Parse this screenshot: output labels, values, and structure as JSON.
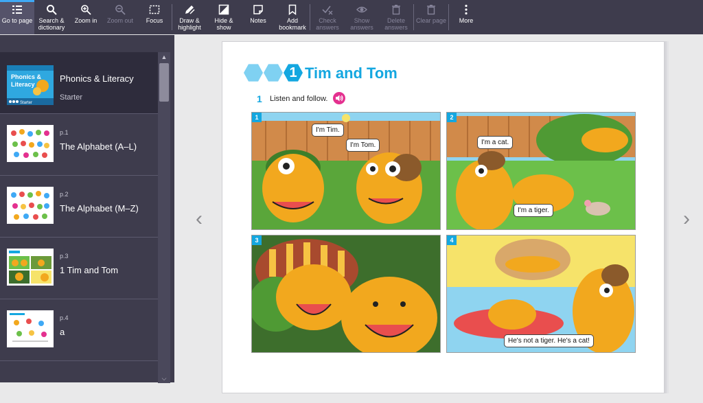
{
  "toolbar": {
    "go_to_page": "Go to page",
    "search_line1": "Search &",
    "search_line2": "dictionary",
    "zoom_in": "Zoom in",
    "zoom_out": "Zoom out",
    "focus": "Focus",
    "draw_line1": "Draw &",
    "draw_line2": "highlight",
    "hide_line1": "Hide &",
    "hide_line2": "show",
    "notes": "Notes",
    "bookmark_line1": "Add",
    "bookmark_line2": "bookmark",
    "check_line1": "Check",
    "check_line2": "answers",
    "show_line1": "Show",
    "show_line2": "answers",
    "delete_line1": "Delete",
    "delete_line2": "answers",
    "clear_page": "Clear page",
    "more": "More"
  },
  "sidebar": {
    "cover": {
      "title": "Phonics & Literacy",
      "subtitle": "Starter",
      "thumb_line1": "Phonics &",
      "thumb_line2": "Literacy",
      "thumb_level": "Starter"
    },
    "items": [
      {
        "page": "p.1",
        "title": "The Alphabet (A–L)"
      },
      {
        "page": "p.2",
        "title": "The Alphabet (M–Z)"
      },
      {
        "page": "p.3",
        "title": "1 Tim and Tom"
      },
      {
        "page": "p.4",
        "title": "a"
      }
    ]
  },
  "page": {
    "unit_number": "1",
    "title": "Tim and Tom",
    "exercise_number": "1",
    "instruction": "Listen and follow.",
    "panels": [
      {
        "number": "1",
        "bubbles": [
          "I'm Tim.",
          "I'm Tom."
        ]
      },
      {
        "number": "2",
        "bubbles": [
          "I'm a cat.",
          "I'm a tiger."
        ]
      },
      {
        "number": "3",
        "bubbles": []
      },
      {
        "number": "4",
        "bubbles": [
          "He's not a tiger. He's a cat!"
        ]
      }
    ]
  },
  "colors": {
    "toolbar_bg": "#3e3c4d",
    "accent": "#14a7e0",
    "active_indicator": "#3fa9f5",
    "audio": "#e4308f"
  }
}
